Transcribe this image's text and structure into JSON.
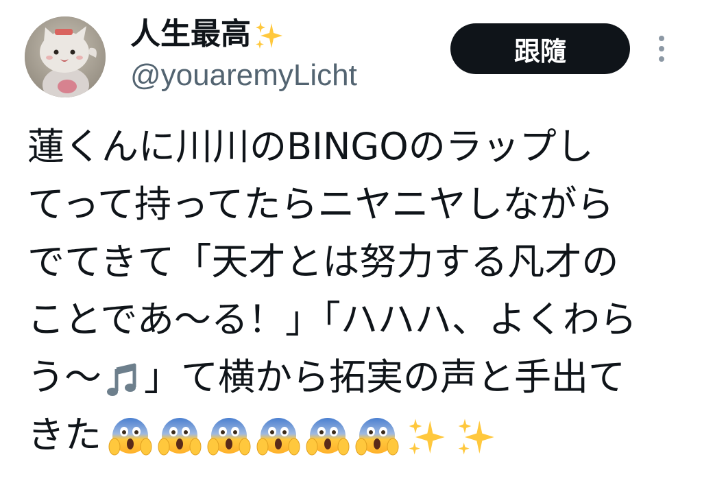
{
  "author": {
    "display_name": "人生最高",
    "display_name_emoji": "sparkles-icon",
    "handle": "@youaremyLicht",
    "avatar_icon": "plush-cat-avatar"
  },
  "actions": {
    "follow_label": "跟隨",
    "more_icon": "more-vertical-icon"
  },
  "tweet": {
    "lines": [
      "蓮くんに川川のBINGOのラップし",
      "てって持ってたらニヤニヤしながら",
      "でてきて「天才とは努力する凡才の",
      "ことであ〜る！」「ハハハ、よくわら",
      "」て横から拓実の声と手出て"
    ],
    "line5_prefix": "う〜",
    "line5_emoji": "musical-notes-icon",
    "line6_text": "きた",
    "line6_emojis": [
      "face-screaming-in-fear-icon",
      "face-screaming-in-fear-icon",
      "face-screaming-in-fear-icon",
      "face-screaming-in-fear-icon",
      "face-screaming-in-fear-icon",
      "face-screaming-in-fear-icon",
      "sparkles-icon",
      "sparkles-icon"
    ]
  },
  "colors": {
    "text_primary": "#0f1419",
    "text_secondary": "#536471",
    "follow_bg": "#0f1419",
    "follow_fg": "#ffffff",
    "emoji_yellow": "#ffc83d",
    "emoji_blue": "#4a7fd0",
    "music_gray": "#6d7f8c"
  }
}
